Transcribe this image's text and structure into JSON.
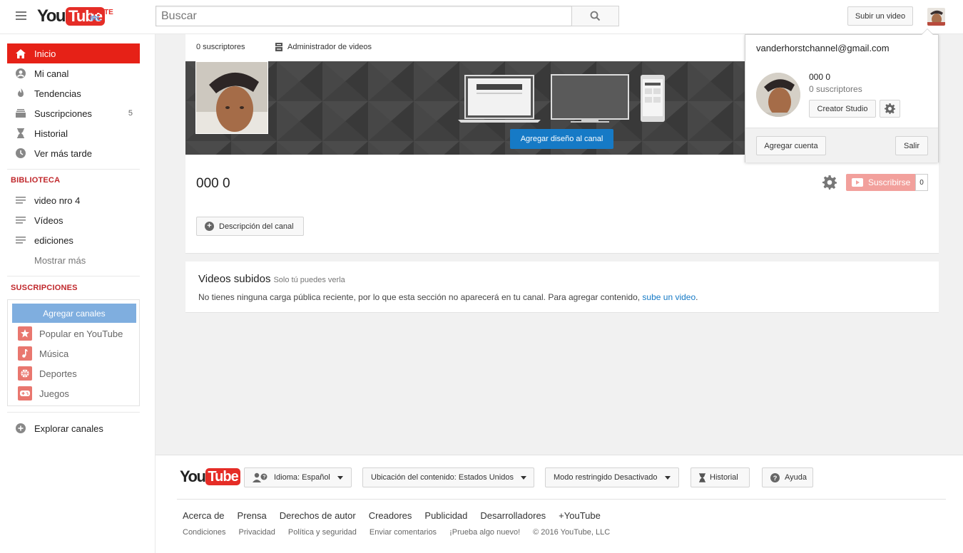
{
  "header": {
    "logo_you": "You",
    "logo_tube": "Tube",
    "vote_line1": "#VOTE",
    "vote_line2": "IRL",
    "search_placeholder": "Buscar",
    "upload_label": "Subir un video"
  },
  "sidebar": {
    "items": [
      {
        "label": "Inicio",
        "icon": "home-icon"
      },
      {
        "label": "Mi canal",
        "icon": "user-icon"
      },
      {
        "label": "Tendencias",
        "icon": "flame-icon"
      },
      {
        "label": "Suscripciones",
        "icon": "subscriptions-icon",
        "count": "5"
      },
      {
        "label": "Historial",
        "icon": "hourglass-icon"
      },
      {
        "label": "Ver más tarde",
        "icon": "clock-icon"
      }
    ],
    "library_title": "BIBLIOTECA",
    "library_items": [
      {
        "label": "video nro 4",
        "icon": "playlist-icon"
      },
      {
        "label": "Vídeos",
        "icon": "playlist-icon"
      },
      {
        "label": "ediciones",
        "icon": "playlist-icon"
      }
    ],
    "show_more": "Mostrar más",
    "subs_title": "SUSCRIPCIONES",
    "add_channels": "Agregar canales",
    "sub_items": [
      {
        "label": "Popular en YouTube",
        "icon": "star-icon"
      },
      {
        "label": "Música",
        "icon": "music-note-icon"
      },
      {
        "label": "Deportes",
        "icon": "ball-icon"
      },
      {
        "label": "Juegos",
        "icon": "gamepad-icon"
      }
    ],
    "explore": "Explorar canales"
  },
  "channel": {
    "subscribers": "0 suscriptores",
    "video_manager": "Administrador de videos",
    "add_design": "Agregar diseño al canal",
    "name": "000 0",
    "subscribe_label": "Suscribirse",
    "subscribe_count": "0",
    "description_btn": "Descripción del canal"
  },
  "videos": {
    "title": "Videos subidos",
    "note": "Solo tú puedes verla",
    "message": "No tienes ninguna carga pública reciente, por lo que esta sección no aparecerá en tu canal. Para agregar contenido,",
    "link": "sube un video",
    "period": "."
  },
  "account_popup": {
    "email": "vanderhorstchannel@gmail.com",
    "name": "000 0",
    "subscribers": "0 suscriptores",
    "creator_studio": "Creator Studio",
    "add_account": "Agregar cuenta",
    "sign_out": "Salir"
  },
  "footer": {
    "language": "Idioma: Español",
    "location": "Ubicación del contenido: Estados Unidos",
    "restricted": "Modo restringido Desactivado",
    "history": "Historial",
    "help": "Ayuda",
    "links": [
      "Acerca de",
      "Prensa",
      "Derechos de autor",
      "Creadores",
      "Publicidad",
      "Desarrolladores",
      "+YouTube"
    ],
    "small_links": [
      "Condiciones",
      "Privacidad",
      "Política y seguridad",
      "Enviar comentarios",
      "¡Prueba algo nuevo!"
    ],
    "copyright": "© 2016 YouTube, LLC"
  },
  "colors": {
    "accent_red": "#e62117",
    "link_blue": "#167ac6",
    "section_title": "#c0282c",
    "subscribe_disabled": "#f2a09c"
  }
}
